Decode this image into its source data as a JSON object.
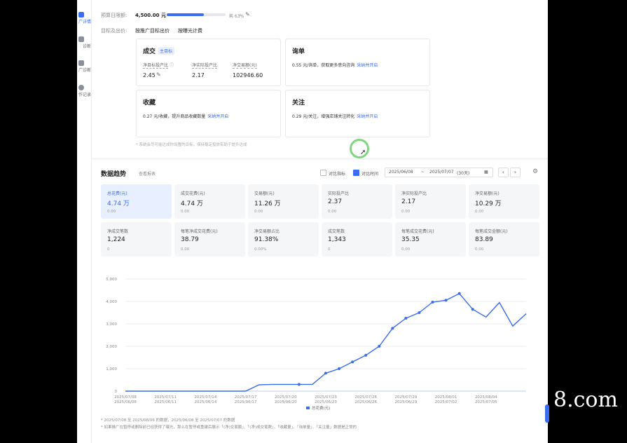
{
  "sidebar": {
    "items": [
      {
        "label": "广详情",
        "active": true
      },
      {
        "label": "诊断",
        "active": false
      },
      {
        "label": "广诊断",
        "active": false
      },
      {
        "label": "作记录",
        "active": false
      }
    ]
  },
  "budget": {
    "label": "预算日限额:",
    "value": "4,500.00 元",
    "usage_text": "耗 63%",
    "usage_fraction": 0.63
  },
  "target": {
    "label": "目标及出价:",
    "opt1": "按推广目标出价",
    "opt2": "按曝光计费"
  },
  "goals": {
    "deal": {
      "title": "成交",
      "badge": "主目标",
      "metrics": [
        {
          "label": "净目标投产比",
          "value": "2.45"
        },
        {
          "label": "净实际投产比",
          "value": "2.17"
        },
        {
          "label": "净交易额(元)",
          "value": "102946.60"
        }
      ]
    },
    "inquiry": {
      "title": "询单",
      "desc": "0.55 元/询单，获取更多意向咨询",
      "link": "采纳并开启"
    },
    "favorite": {
      "title": "收藏",
      "desc": "0.27 元/收藏，提升商品收藏数量",
      "link": "采纳并开启"
    },
    "follow": {
      "title": "关注",
      "desc": "0.29 元/关注，增强店铺关注转化",
      "link": "采纳并开启"
    },
    "note": "* 系统会尽可能达成你设置的目标，保持稳定投放有助于提升达成"
  },
  "trend": {
    "title": "数据趋势",
    "link": "查看报表",
    "compare_metric_label": "对比指标",
    "compare_time_label": "对比时间",
    "date_start": "2025/06/08",
    "date_sep": "~",
    "date_end": "2025/07/07",
    "date_range": "(30天)",
    "prev": "‹",
    "next": "›"
  },
  "kpis": [
    {
      "label": "总花费(元)",
      "value": "4.74 万",
      "change": "0.00"
    },
    {
      "label": "成交花费(元)",
      "value": "4.74 万",
      "change": "0.00"
    },
    {
      "label": "交易额(元)",
      "value": "11.26 万",
      "change": "0.00"
    },
    {
      "label": "实际投产比",
      "value": "2.37",
      "change": "0.00"
    },
    {
      "label": "净实际投产比",
      "value": "2.17",
      "change": "0.00"
    },
    {
      "label": "净交易额(元)",
      "value": "10.29 万",
      "change": "0.00"
    },
    {
      "label": "净成交笔数",
      "value": "1,224",
      "change": "0"
    },
    {
      "label": "每笔净成交花费(元)",
      "value": "38.79",
      "change": "0.00"
    },
    {
      "label": "净交易额占比",
      "value": "91.38%",
      "change": "0.00%"
    },
    {
      "label": "成交笔数",
      "value": "1,343",
      "change": "0"
    },
    {
      "label": "每笔成交花费(元)",
      "value": "35.35",
      "change": "0.00"
    },
    {
      "label": "每笔成交金额(元)",
      "value": "83.89",
      "change": "0.00"
    }
  ],
  "chart_data": {
    "type": "line",
    "legend": "总花费(元)",
    "ylim": [
      0,
      5000
    ],
    "yticks": [
      "0",
      "1,000",
      "2,000",
      "3,000",
      "4,000",
      "5,000"
    ],
    "xticks_top": [
      "2025/07/08",
      "2025/07/11",
      "2025/07/14",
      "2025/07/17",
      "2025/07/20",
      "2025/07/23",
      "2025/07/26",
      "2025/07/29",
      "2025/08/01",
      "2025/08/04"
    ],
    "xticks_bottom": [
      "2025/06/08",
      "2025/06/11",
      "2025/06/14",
      "2025/06/17",
      "2025/06/20",
      "2025/06/23",
      "2025/06/26",
      "2025/06/29",
      "2025/07/02",
      "2025/07/05"
    ],
    "series": [
      {
        "name": "current",
        "color": "#3b6df0",
        "values": [
          0,
          0,
          0,
          0,
          0,
          0,
          0,
          0,
          0,
          0,
          280,
          300,
          300,
          300,
          300,
          800,
          1000,
          1300,
          1600,
          2000,
          2800,
          3250,
          3500,
          3970,
          4050,
          4350,
          3650,
          3300,
          3950,
          2900,
          3450
        ]
      },
      {
        "name": "compare",
        "color": "#c9d6f8",
        "values": [
          0,
          0,
          0,
          0,
          0,
          0,
          0,
          0,
          0,
          0,
          0,
          0,
          0,
          0,
          0,
          0,
          0,
          0,
          0,
          0,
          0,
          0,
          0,
          0,
          0,
          0,
          0,
          0,
          0,
          0,
          0
        ]
      }
    ],
    "markers": [
      13,
      15,
      16,
      17,
      18,
      19,
      20,
      21,
      22,
      23,
      24,
      25,
      26
    ]
  },
  "footnotes": [
    "* 2025/07/08 至 2025/08/06 的数据，2025/06/08 至 2025/07/07 的数据",
    "* 如果推广在暂停或删除前已经获得了曝光，那么在暂停或重建后展示「(净)交易额」、「(净)成交笔数」、「收藏量」、「询单量」、「关注量」数据是正常的"
  ],
  "watermark": "8.com"
}
